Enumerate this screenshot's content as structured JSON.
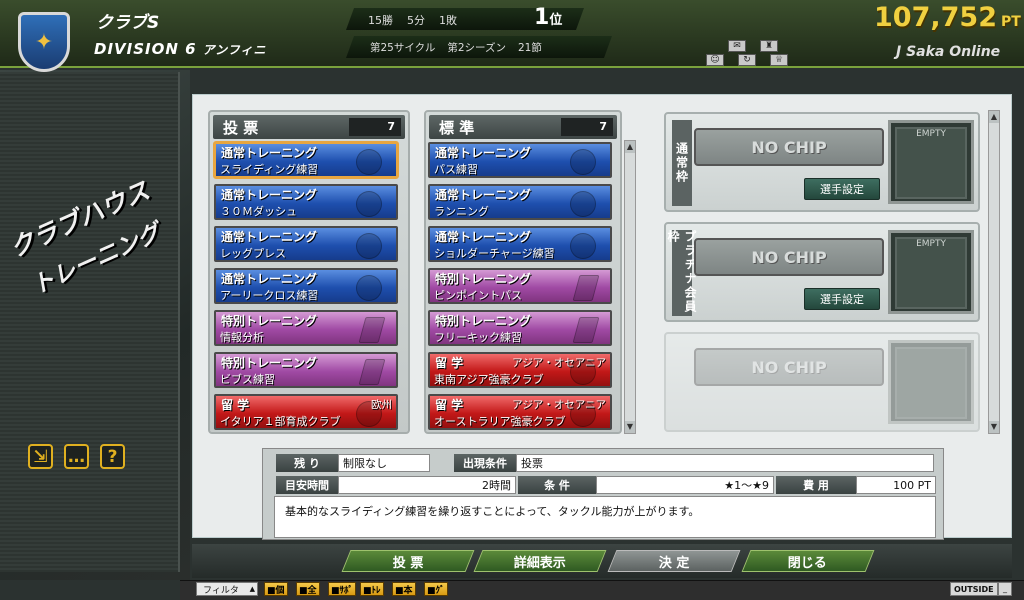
{
  "header": {
    "club_name": "クラブS",
    "division": "DIVISION 6",
    "division_sub": "アンフィニ",
    "record": [
      "15勝",
      "5分",
      "1敗"
    ],
    "rank_num": "1",
    "rank_suffix": "位",
    "cycle": [
      "第25サイクル",
      "第2シーズン",
      "21節"
    ],
    "points": "107,752",
    "points_unit": "PT",
    "service_name": "J Saka Online"
  },
  "sidebar": {
    "title_line1": "クラブハウス",
    "title_line2": "トレーニング",
    "buttons": [
      {
        "icon": "exit-icon",
        "glyph": "⇲"
      },
      {
        "icon": "chat-icon",
        "glyph": "…"
      },
      {
        "icon": "help-icon",
        "glyph": "?"
      }
    ]
  },
  "vote_column": {
    "title": "投 票",
    "count": "7",
    "cards": [
      {
        "type": "blue",
        "category": "通常トレーニング",
        "name": "スライディング練習",
        "selected": true
      },
      {
        "type": "blue",
        "category": "通常トレーニング",
        "name": "３０Ｍダッシュ"
      },
      {
        "type": "blue",
        "category": "通常トレーニング",
        "name": "レッグプレス"
      },
      {
        "type": "blue",
        "category": "通常トレーニング",
        "name": "アーリークロス練習"
      },
      {
        "type": "purple",
        "category": "特別トレーニング",
        "name": "情報分析"
      },
      {
        "type": "purple",
        "category": "特別トレーニング",
        "name": "ビブス練習"
      },
      {
        "type": "red",
        "category": "留 学",
        "name": "イタリア１部育成クラブ",
        "region": "欧州"
      }
    ]
  },
  "standard_column": {
    "title": "標 準",
    "count": "7",
    "cards": [
      {
        "type": "blue",
        "category": "通常トレーニング",
        "name": "パス練習"
      },
      {
        "type": "blue",
        "category": "通常トレーニング",
        "name": "ランニング"
      },
      {
        "type": "blue",
        "category": "通常トレーニング",
        "name": "ショルダーチャージ練習"
      },
      {
        "type": "purple",
        "category": "特別トレーニング",
        "name": "ピンポイントパス"
      },
      {
        "type": "purple",
        "category": "特別トレーニング",
        "name": "フリーキック練習"
      },
      {
        "type": "red",
        "category": "留 学",
        "name": "東南アジア強豪クラブ",
        "region": "アジア・オセアニア"
      },
      {
        "type": "red",
        "category": "留 学",
        "name": "オーストラリア強豪クラブ",
        "region": "アジア・オセアニア"
      }
    ]
  },
  "chip_slots": [
    {
      "label": "通常枠",
      "chip": "NO CHIP",
      "button": "選手設定",
      "card": "EMPTY",
      "enabled": true
    },
    {
      "label": "プラチナ会員枠",
      "chip": "NO CHIP",
      "button": "選手設定",
      "card": "EMPTY",
      "enabled": true
    },
    {
      "label": "",
      "chip": "NO CHIP",
      "button": "",
      "card": "",
      "enabled": false
    }
  ],
  "info": {
    "remaining_label": "残 り",
    "remaining_value": "制限なし",
    "condition_label": "出現条件",
    "condition_value": "投票",
    "time_label": "目安時間",
    "time_value": "2時間",
    "req_label": "条 件",
    "req_value": "★1〜★9",
    "cost_label": "費 用",
    "cost_value": "100 PT",
    "description": "基本的なスライディング練習を繰り返すことによって、タックル能力が上がります。"
  },
  "buttons": {
    "vote": "投 票",
    "details": "詳細表示",
    "confirm": "決 定",
    "close": "閉じる"
  },
  "filter": {
    "label": "フィルタ",
    "tabs": [
      "個",
      "全",
      "ｻﾎﾟ",
      "ﾄﾚ",
      "本",
      "ｸﾞ"
    ],
    "outside": "OUTSIDE"
  }
}
